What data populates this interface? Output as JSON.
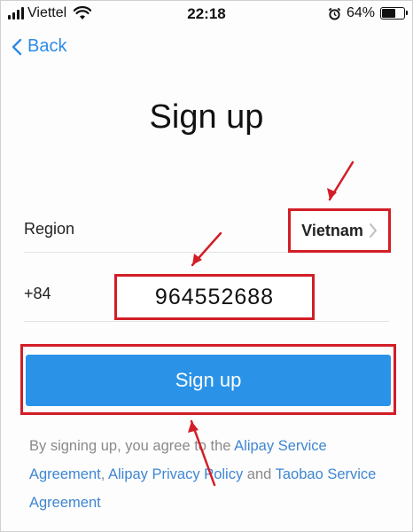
{
  "status_bar": {
    "carrier": "Viettel",
    "time": "22:18",
    "battery_percent": "64%",
    "battery_level": 0.64,
    "icons": [
      "signal-icon",
      "wifi-icon",
      "alarm-icon",
      "battery-icon"
    ]
  },
  "nav": {
    "back_label": "Back"
  },
  "page": {
    "title": "Sign up"
  },
  "form": {
    "region_label": "Region",
    "region_value": "Vietnam",
    "country_code": "+84",
    "phone_value": "964552688"
  },
  "actions": {
    "signup_label": "Sign up"
  },
  "terms": {
    "prefix": "By signing up, you agree to the ",
    "link1": "Alipay Service Agreement",
    "sep": ", ",
    "link2": "Alipay Privacy Policy",
    "and": " and ",
    "link3": "Taobao Service Agreement"
  },
  "colors": {
    "accent": "#2a93e8",
    "link": "#3f86d2",
    "annotation": "#d21e27"
  }
}
